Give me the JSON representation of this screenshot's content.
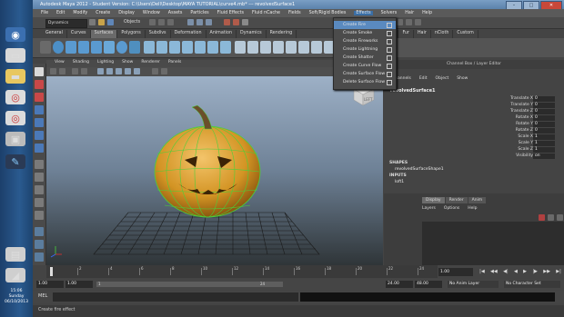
{
  "taskbar": {
    "clock_time": "15:06",
    "clock_day": "Sunday",
    "clock_date": "06/10/2013"
  },
  "window": {
    "title": "Autodesk Maya 2012 - Student Version: C:\\Users\\Dell\\Desktop\\MAYA TUTORIAL\\curve4.mb* --- revolvedSurface1",
    "buttons": {
      "minimize": "–",
      "maximize": "□",
      "close": "✕"
    }
  },
  "menubar": {
    "items": [
      "File",
      "Edit",
      "Modify",
      "Create",
      "Display",
      "Window",
      "Assets",
      "Particles",
      "Fluid Effects",
      "Fluid nCache",
      "Fields",
      "Soft/Rigid Bodies",
      "Effects",
      "Solvers",
      "Hair",
      "Help"
    ]
  },
  "statusline": {
    "mode": "Dynamics",
    "objects_label": "Objects"
  },
  "shelf": {
    "tabs": [
      "General",
      "Curves",
      "Surfaces",
      "Polygons",
      "Subdivs",
      "Deformation",
      "Animation",
      "Dynamics",
      "Rendering",
      "",
      "nParticles",
      "Fluids",
      "Fur",
      "Hair",
      "nCloth",
      "Custom"
    ],
    "active_tab": "Surfaces"
  },
  "effects_menu": {
    "items": [
      "Create Fire",
      "Create Smoke",
      "Create Fireworks",
      "Create Lightning",
      "Create Shatter",
      "Create Curve Flow",
      "Create Surface Flow",
      "Delete Surface Flow"
    ],
    "highlighted": "Create Fire"
  },
  "viewport": {
    "menu": [
      "View",
      "Shading",
      "Lighting",
      "Show",
      "Renderer",
      "Panels"
    ],
    "viewcube_label": "LEFT"
  },
  "channel_box": {
    "header": "Channel Box / Layer Editor",
    "menu": [
      "Channels",
      "Edit",
      "Object",
      "Show"
    ],
    "object_name": "revolvedSurface1",
    "attributes": [
      {
        "name": "Translate X",
        "value": "0"
      },
      {
        "name": "Translate Y",
        "value": "0"
      },
      {
        "name": "Translate Z",
        "value": "0"
      },
      {
        "name": "Rotate X",
        "value": "0"
      },
      {
        "name": "Rotate Y",
        "value": "0"
      },
      {
        "name": "Rotate Z",
        "value": "0"
      },
      {
        "name": "Scale X",
        "value": "1"
      },
      {
        "name": "Scale Y",
        "value": "1"
      },
      {
        "name": "Scale Z",
        "value": "1"
      },
      {
        "name": "Visibility",
        "value": "on"
      }
    ],
    "shapes_label": "SHAPES",
    "shape_name": "revolvedSurfaceShape1",
    "inputs_label": "INPUTS",
    "input_name": "loft1"
  },
  "layer_editor": {
    "tabs": [
      "Display",
      "Render",
      "Anim"
    ],
    "active_tab": "Display",
    "menu": [
      "Layers",
      "Options",
      "Help"
    ]
  },
  "timeline": {
    "ticks": [
      "2",
      "4",
      "6",
      "8",
      "10",
      "12",
      "14",
      "16",
      "18",
      "20",
      "22",
      "24"
    ],
    "current_frame": "1.00",
    "playback": [
      "|◀",
      "◀◀",
      "◀|",
      "◀",
      "▶",
      "|▶",
      "▶▶",
      "▶|"
    ]
  },
  "range": {
    "start": "1.00",
    "start2": "1.00",
    "slider_start": "1",
    "slider_end": "24",
    "end": "24.00",
    "end2": "48.00",
    "anim_layer": "No Anim Layer",
    "char_set": "No Character Set"
  },
  "command_line": {
    "label": "MEL"
  },
  "help_line": {
    "text": "Create fire effect"
  }
}
